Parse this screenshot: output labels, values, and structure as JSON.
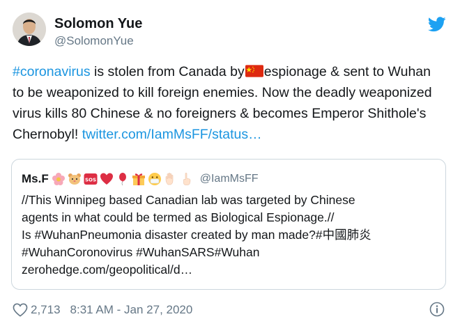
{
  "tweet": {
    "author_name": "Solomon Yue",
    "author_handle": "@SolomonYue",
    "text_hashtag": "#coronavirus",
    "text_part1": " is stolen from Canada by",
    "text_part2": "espionage & sent to Wuhan to be weaponized to kill foreign enemies. Now the deadly weaponized virus kills 80 Chinese & no foreigners & becomes Emperor Shithole's Chernobyl! ",
    "text_link": "twitter.com/IamMsFF/status…",
    "likes": "2,713",
    "timestamp": "8:31 AM - Jan 27, 2020"
  },
  "quote": {
    "name": "Ms.F",
    "handle": "@IamMsFF",
    "line1": "//This Winnipeg based Canadian lab was targeted by Chinese",
    "line2": "agents in what could be termed as Biological Espionage.//",
    "line3": "Is #WuhanPneumonia disaster created by man made?#中國肺炎",
    "line4": "#WuhanCoronovirus #WuhanSARS#Wuhan",
    "line5": "zerohedge.com/geopolitical/d…",
    "emoji_icons": [
      "flower-icon",
      "hamster-icon",
      "sos-icon",
      "red-heart-icon",
      "balloon-icon",
      "gift-icon",
      "mask-face-icon",
      "raised-hand-icon",
      "pointing-up-icon"
    ]
  },
  "colors": {
    "link": "#1b95e0",
    "muted": "#657786",
    "border": "#ccd6dd",
    "twitter_blue": "#1da1f2"
  },
  "icons": {
    "brand": "twitter-bird-icon",
    "like": "heart-outline-icon",
    "info": "info-icon",
    "flag": "china-flag-icon"
  }
}
